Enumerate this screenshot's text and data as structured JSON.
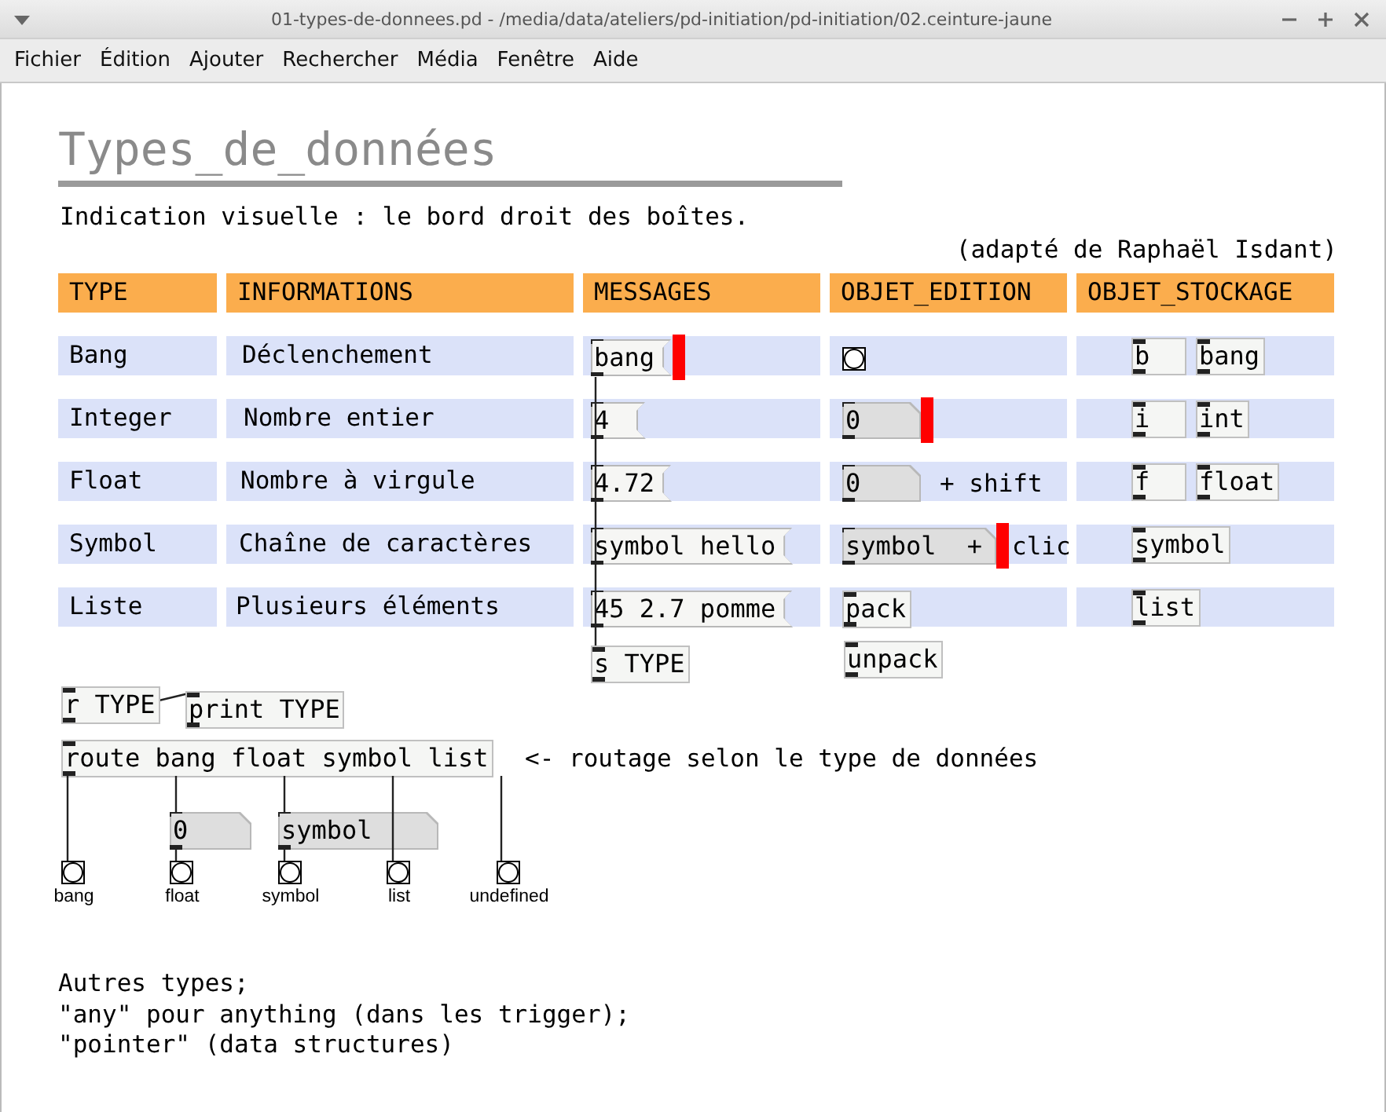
{
  "window": {
    "title": "01-types-de-donnees.pd  - /media/data/ateliers/pd-initiation/pd-initiation/02.ceinture-jaune"
  },
  "menu": [
    "Fichier",
    "Édition",
    "Ajouter",
    "Rechercher",
    "Média",
    "Fenêtre",
    "Aide"
  ],
  "patch": {
    "title": "Types_de_données",
    "subtitle": "Indication visuelle : le bord droit des boîtes.",
    "credit": "(adapté de Raphaël Isdant)",
    "headers": [
      "TYPE",
      "INFORMATIONS",
      "MESSAGES",
      "OBJET_EDITION",
      "OBJET_STOCKAGE"
    ],
    "rows": [
      {
        "type": "Bang",
        "info": "Déclenchement",
        "message": {
          "text": "bang",
          "highlighted": true
        },
        "edition": {
          "kind": "bang",
          "highlighted": false
        },
        "storage": [
          "b",
          "bang"
        ]
      },
      {
        "type": "Integer",
        "info": "Nombre entier",
        "message": {
          "text": "4",
          "highlighted": false
        },
        "edition": {
          "kind": "number",
          "text": "0",
          "highlighted": true
        },
        "storage": [
          "i",
          "int"
        ]
      },
      {
        "type": "Float",
        "info": "Nombre à virgule",
        "message": {
          "text": "4.72",
          "highlighted": false
        },
        "edition": {
          "kind": "number",
          "text": "0",
          "highlighted": false,
          "note": "+ shift"
        },
        "storage": [
          "f",
          "float"
        ]
      },
      {
        "type": "Symbol",
        "info": "Chaîne de caractères",
        "message": {
          "text": "symbol hello",
          "highlighted": false
        },
        "edition": {
          "kind": "symbol",
          "text": "symbol",
          "inner": "+",
          "highlighted": true,
          "note": "clic"
        },
        "storage": [
          "symbol"
        ]
      },
      {
        "type": "Liste",
        "info": "Plusieurs éléments",
        "message": {
          "text": "45 2.7 pomme",
          "highlighted": false
        },
        "edition": {
          "kind": "object",
          "text": "pack",
          "highlighted": false
        },
        "storage": [
          "list"
        ]
      }
    ],
    "send": "s TYPE",
    "unpack": "unpack",
    "receive": "r TYPE",
    "print": "print TYPE",
    "route": "route bang float symbol list",
    "route_note": "<- routage selon le type de données",
    "float_box": "0",
    "symbol_box": "symbol",
    "outputs": [
      "bang",
      "float",
      "symbol",
      "list",
      "undefined"
    ],
    "notes": [
      "Autres types;",
      "\"any\" pour anything (dans les trigger);",
      "\"pointer\" (data structures)"
    ]
  }
}
